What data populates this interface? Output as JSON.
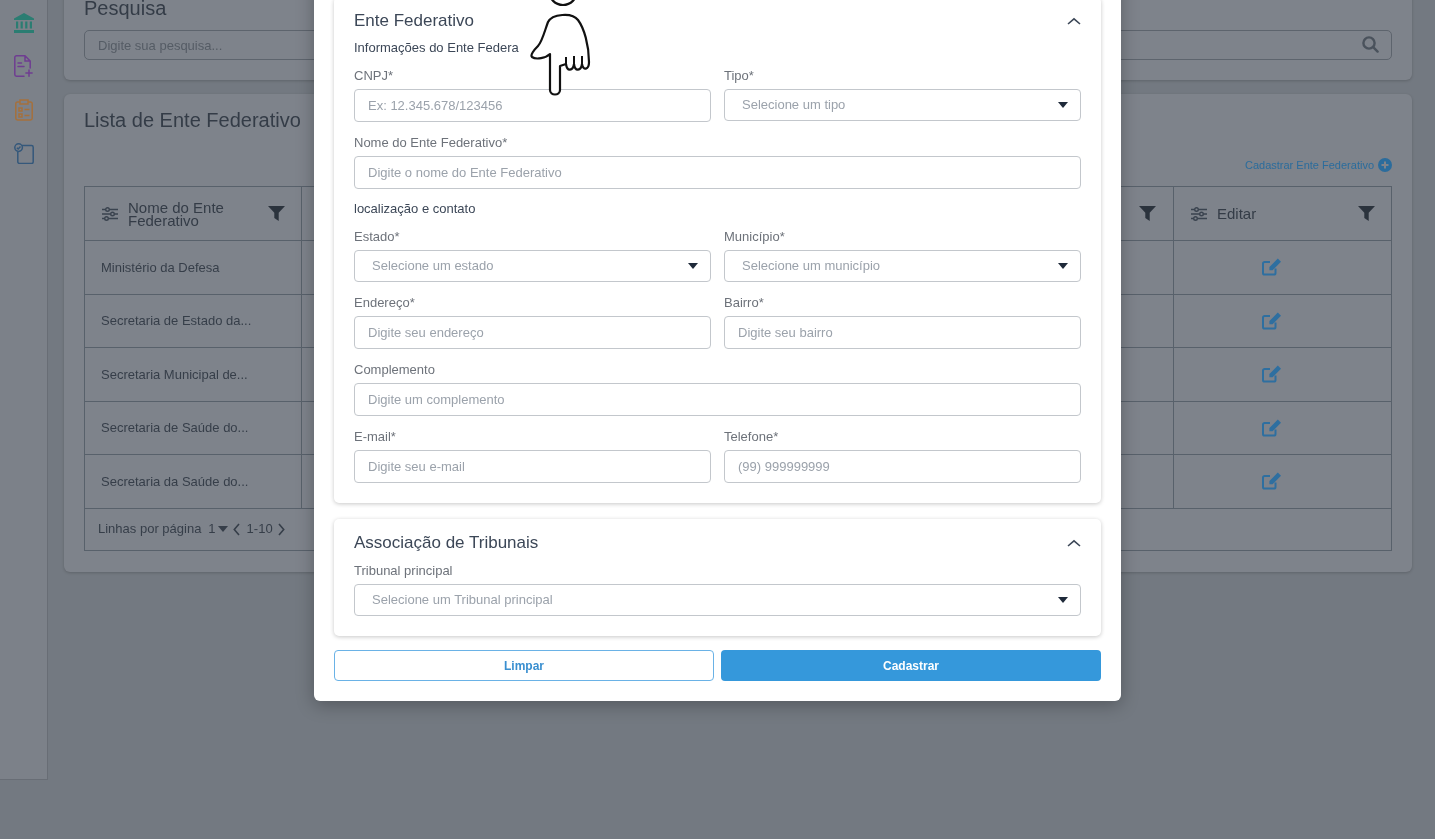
{
  "search_panel": {
    "title": "Pesquisa",
    "search": {
      "placeholder": "Digite sua pesquisa..."
    }
  },
  "list_panel": {
    "title": "Lista de Ente Federativo",
    "add_link": "Cadastrar Ente Federativo",
    "table": {
      "columns": [
        {
          "label": "Nome do Ente Federativo"
        },
        {
          "label": "Editar"
        }
      ],
      "rows": [
        {
          "name": "Ministério da Defesa"
        },
        {
          "name": "Secretaria de Estado da..."
        },
        {
          "name": "Secretaria Municipal de..."
        },
        {
          "name": "Secretaria de Saúde do..."
        },
        {
          "name": "Secretaria da Saúde do..."
        }
      ],
      "pagination": {
        "label": "Linhas por página",
        "page_size": "1",
        "range": "1-10"
      }
    }
  },
  "modal": {
    "sections": [
      {
        "title": "Ente Federativo",
        "expanded": true,
        "blocks": [
          {
            "kind": "subheading",
            "text": "Informações do Ente Federa"
          },
          {
            "kind": "fields",
            "fields": [
              {
                "kind": "input",
                "label": "CNPJ*",
                "placeholder": "Ex: 12.345.678/123456"
              },
              {
                "kind": "select",
                "label": "Tipo*",
                "placeholder": "Selecione um tipo"
              }
            ]
          },
          {
            "kind": "fields",
            "fields": [
              {
                "kind": "input",
                "label": "Nome do Ente Federativo*",
                "placeholder": "Digite o nome do Ente Federativo"
              }
            ]
          },
          {
            "kind": "subheading",
            "text": "localização e contato"
          },
          {
            "kind": "fields",
            "fields": [
              {
                "kind": "select",
                "label": "Estado*",
                "placeholder": "Selecione um estado"
              },
              {
                "kind": "select",
                "label": "Município*",
                "placeholder": "Selecione um município"
              }
            ]
          },
          {
            "kind": "fields",
            "fields": [
              {
                "kind": "input",
                "label": "Endereço*",
                "placeholder": "Digite seu endereço"
              },
              {
                "kind": "input",
                "label": "Bairro*",
                "placeholder": "Digite seu bairro"
              }
            ]
          },
          {
            "kind": "fields",
            "fields": [
              {
                "kind": "input",
                "label": "Complemento",
                "placeholder": "Digite um complemento"
              }
            ]
          },
          {
            "kind": "fields",
            "fields": [
              {
                "kind": "input",
                "label": "E-mail*",
                "placeholder": "Digite seu e-mail"
              },
              {
                "kind": "input",
                "label": "Telefone*",
                "placeholder": "(99) 999999999"
              }
            ]
          }
        ]
      },
      {
        "title": "Associação de Tribunais",
        "expanded": true,
        "blocks": [
          {
            "kind": "fields",
            "fields": [
              {
                "kind": "select",
                "label": "Tribunal principal",
                "placeholder": "Selecione um Tribunal principal"
              }
            ]
          }
        ]
      }
    ],
    "buttons": [
      {
        "kind": "outline",
        "label": "Limpar"
      },
      {
        "kind": "primary",
        "label": "Cadastrar"
      }
    ]
  }
}
